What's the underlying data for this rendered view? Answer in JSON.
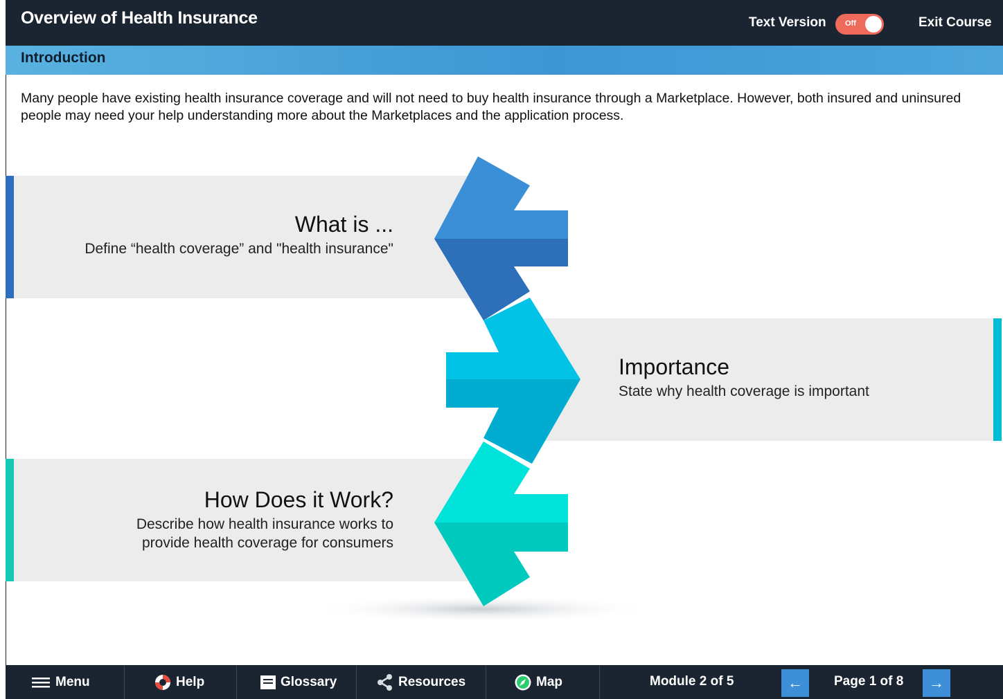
{
  "header": {
    "title": "Overview of Health Insurance",
    "text_version_label": "Text Version",
    "toggle_state": "Off",
    "exit_label": "Exit Course"
  },
  "section": {
    "title": "Introduction"
  },
  "intro_text": "Many people have existing health insurance coverage and will not need to buy health insurance through a Marketplace. However, both insured and uninsured people may need your help understanding more about the Marketplaces and the application process.",
  "topics": [
    {
      "title": "What is ...",
      "desc": [
        "Define “health coverage” and \"health insurance\""
      ],
      "color": "#2d6fbd"
    },
    {
      "title": "Importance",
      "desc": [
        "State why health coverage is important"
      ],
      "color": "#00bcd4"
    },
    {
      "title": "How Does it Work?",
      "desc": [
        "Describe how health insurance works to",
        "provide health coverage for consumers"
      ],
      "color": "#13c9b3"
    }
  ],
  "footer": {
    "menu": "Menu",
    "help": "Help",
    "glossary": "Glossary",
    "resources": "Resources",
    "map": "Map",
    "module": "Module 2 of 5",
    "page": "Page 1 of 8",
    "prev_icon": "arrow-left-icon",
    "next_icon": "arrow-right-icon"
  }
}
